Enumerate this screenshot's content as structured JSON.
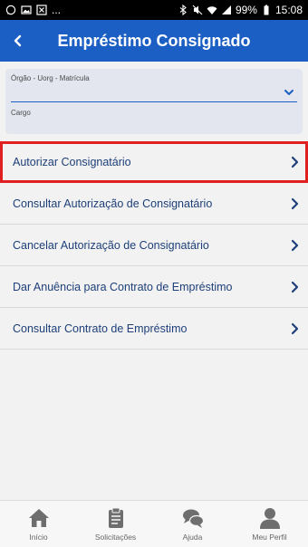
{
  "status_bar": {
    "left_dots": "...",
    "battery": "99%",
    "time": "15:08"
  },
  "header": {
    "title": "Empréstimo Consignado"
  },
  "form": {
    "orgao_label": "Órgão - Uorg - Matrícula",
    "cargo_label": "Cargo"
  },
  "menu": {
    "items": [
      {
        "label": "Autorizar Consignatário"
      },
      {
        "label": "Consultar Autorização de Consignatário"
      },
      {
        "label": "Cancelar Autorização de Consignatário"
      },
      {
        "label": "Dar Anuência para Contrato de Empréstimo"
      },
      {
        "label": "Consultar Contrato de Empréstimo"
      }
    ]
  },
  "bottom_nav": {
    "items": [
      {
        "label": "Início",
        "icon": "home-icon"
      },
      {
        "label": "Solicitações",
        "icon": "clipboard-icon"
      },
      {
        "label": "Ajuda",
        "icon": "chat-icon"
      },
      {
        "label": "Meu Perfil",
        "icon": "user-icon"
      }
    ]
  },
  "colors": {
    "primary": "#1c5fc4",
    "menu_text": "#1d3f79",
    "highlight": "#e02020"
  }
}
